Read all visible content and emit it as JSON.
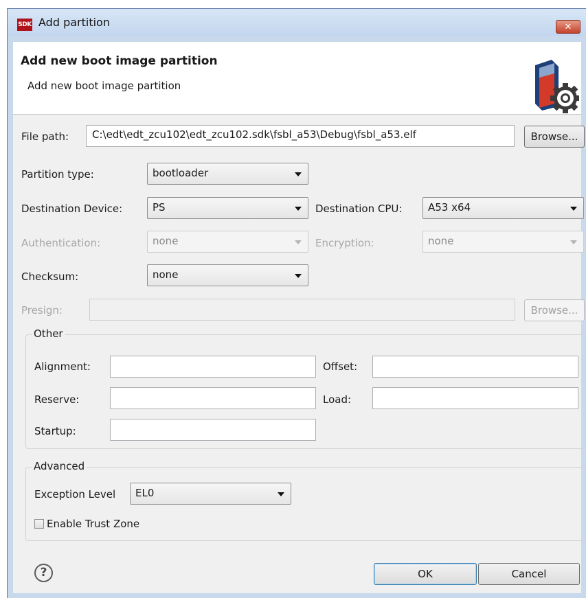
{
  "window": {
    "title": "Add partition",
    "app_icon_text": "SDK",
    "close_icon": "close-x-icon"
  },
  "header": {
    "title": "Add new boot image partition",
    "description": "Add new boot image partition",
    "icon": "boot-image-gear-icon"
  },
  "file_path": {
    "label": "File path:",
    "value": "C:\\edt\\edt_zcu102\\edt_zcu102.sdk\\fsbl_a53\\Debug\\fsbl_a53.elf",
    "browse_label": "Browse..."
  },
  "partition_type": {
    "label": "Partition type:",
    "value": "bootloader"
  },
  "destination_device": {
    "label": "Destination Device:",
    "value": "PS"
  },
  "destination_cpu": {
    "label": "Destination CPU:",
    "value": "A53 x64"
  },
  "authentication": {
    "label": "Authentication:",
    "value": "none",
    "enabled": false
  },
  "encryption": {
    "label": "Encryption:",
    "value": "none",
    "enabled": false
  },
  "checksum": {
    "label": "Checksum:",
    "value": "none"
  },
  "presign": {
    "label": "Presign:",
    "value": "",
    "browse_label": "Browse...",
    "enabled": false
  },
  "other": {
    "legend": "Other",
    "alignment_label": "Alignment:",
    "alignment_value": "",
    "offset_label": "Offset:",
    "offset_value": "",
    "reserve_label": "Reserve:",
    "reserve_value": "",
    "load_label": "Load:",
    "load_value": "",
    "startup_label": "Startup:",
    "startup_value": ""
  },
  "advanced": {
    "legend": "Advanced",
    "exception_level_label": "Exception Level",
    "exception_level_value": "EL0",
    "trust_zone_label": "Enable Trust Zone",
    "trust_zone_checked": false
  },
  "footer": {
    "help_symbol": "?",
    "ok_label": "OK",
    "cancel_label": "Cancel"
  },
  "colors": {
    "window_frame": "#c9d9ec",
    "dialog_bg": "#f0f0f0",
    "close_button": "#c4432a",
    "default_button_border": "#3c7fb1"
  }
}
